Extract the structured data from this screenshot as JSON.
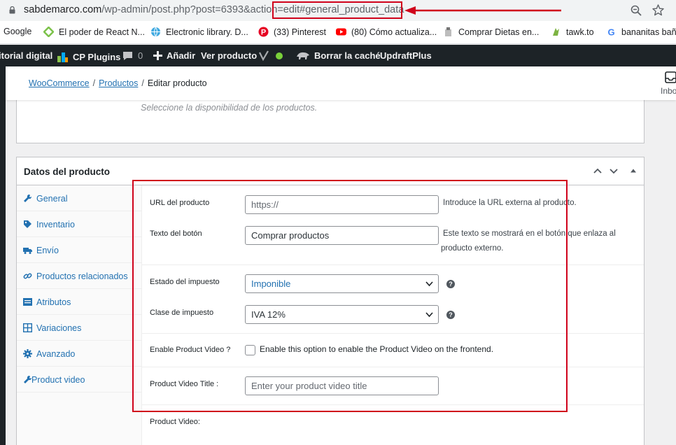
{
  "browser": {
    "url_host": "sabdemarco.com",
    "url_path": "/wp-admin/post.php?post=6393&action=edit#general_product_data",
    "icons": [
      "lock-icon",
      "zoom-icon",
      "star-icon"
    ]
  },
  "bookmarks": [
    {
      "label": "Google",
      "icon": "none"
    },
    {
      "label": "El poder de React N...",
      "icon": "react-diamond-icon",
      "color": "#7cc24a"
    },
    {
      "label": "Electronic library. D...",
      "icon": "globe-icon",
      "color": "#3fa9e0"
    },
    {
      "label": "(33) Pinterest",
      "icon": "pinterest-icon",
      "color": "#e60023"
    },
    {
      "label": "(80) Cómo actualiza...",
      "icon": "youtube-icon",
      "color": "#ff0000"
    },
    {
      "label": "Comprar Dietas en...",
      "icon": "diet-icon",
      "color": "#9e9e9e"
    },
    {
      "label": "tawk.to",
      "icon": "tawk-icon",
      "color": "#7cb342"
    },
    {
      "label": "bananitas baña",
      "icon": "google-icon",
      "color": "#4285f4"
    }
  ],
  "adminbar": {
    "site": "itorial digital",
    "cp_plugins": "CP Plugins",
    "comments_count": "0",
    "add_new": "Añadir",
    "view_product": "Ver producto",
    "clear_cache": "Borrar la caché",
    "updraft": "UpdraftPlus"
  },
  "wc_header": {
    "breadcrumb_1": "WooCommerce",
    "breadcrumb_2": "Productos",
    "current": "Editar producto",
    "sep": "/",
    "inbox": "Inbo"
  },
  "prev_panel": {
    "availability_text": "Seleccione la disponibilidad de los productos."
  },
  "product_data": {
    "title": "Datos del producto",
    "tabs": [
      {
        "label": "General",
        "icon": "wrench-icon"
      },
      {
        "label": "Inventario",
        "icon": "tag-icon"
      },
      {
        "label": "Envío",
        "icon": "truck-icon"
      },
      {
        "label": "Productos relacionados",
        "icon": "link-icon"
      },
      {
        "label": "Atributos",
        "icon": "list-icon"
      },
      {
        "label": "Variaciones",
        "icon": "grid-icon"
      },
      {
        "label": "Avanzado",
        "icon": "gear-icon"
      },
      {
        "label": "Product video",
        "icon": "wrench-icon"
      }
    ],
    "fields": {
      "url_label": "URL del producto",
      "url_placeholder": "https://",
      "url_desc": "Introduce la URL externa al producto.",
      "button_label": "Texto del botón",
      "button_value": "Comprar productos",
      "button_desc_1": "Este texto se mostrará en el botón que enlaza al",
      "button_desc_2": "producto externo.",
      "tax_status_label": "Estado del impuesto",
      "tax_status_value": "Imponible",
      "tax_class_label": "Clase de impuesto",
      "tax_class_value": "IVA 12%",
      "video_enable_label": "Enable Product Video ?",
      "video_enable_desc": "Enable this option to enable the Product Video on the frontend.",
      "video_title_label": "Product Video Title :",
      "video_title_placeholder": "Enter your product video title",
      "video_label": "Product Video:",
      "help": "?"
    }
  },
  "annotation_color": "#d0021b"
}
